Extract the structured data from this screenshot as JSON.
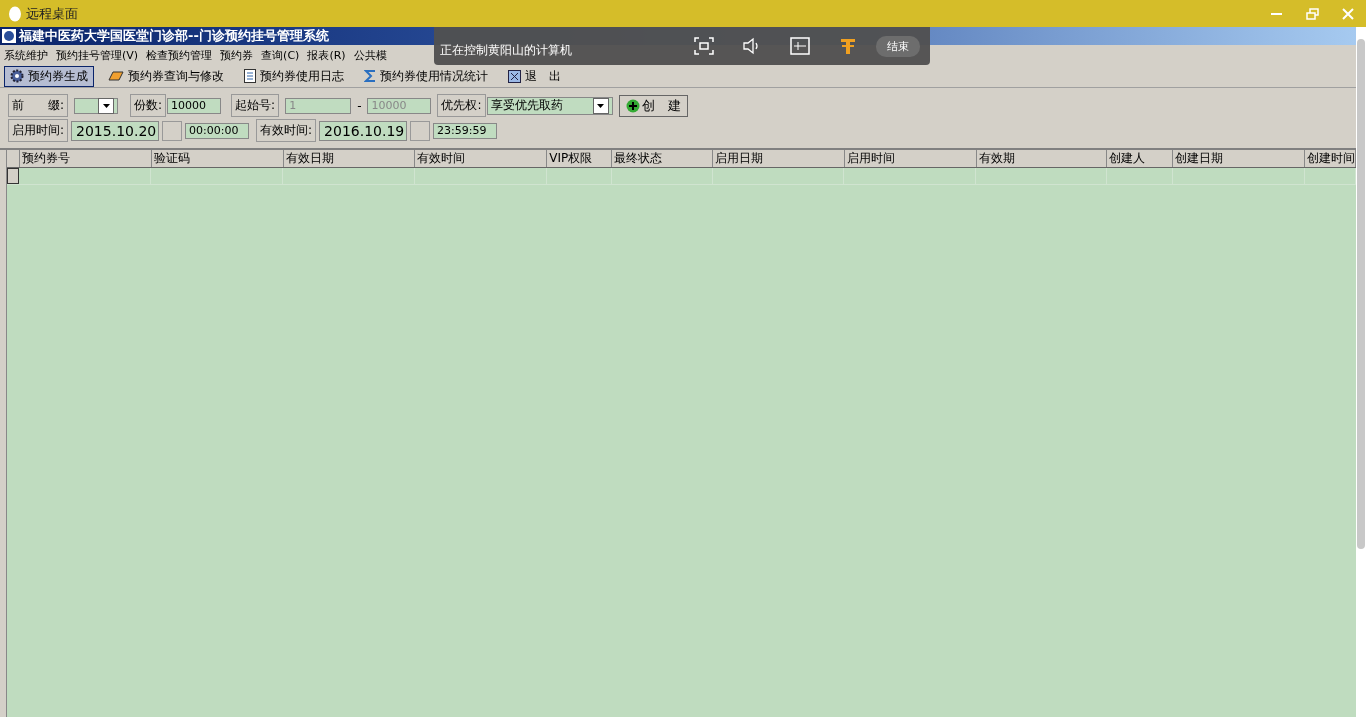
{
  "remote_window": {
    "title": "远程桌面"
  },
  "app_title": "福建中医药大学国医堂门诊部--门诊预约挂号管理系统",
  "menu": [
    "系统维护",
    "预约挂号管理(V)",
    "检查预约管理",
    "预约券",
    "查询(C)",
    "报表(R)",
    "公共模"
  ],
  "remote_bar": {
    "status": "正在控制黄阳山的计算机",
    "end_button": "结束"
  },
  "toolbar": [
    {
      "label": "预约券生成",
      "selected": true,
      "kind": "gear"
    },
    {
      "label": "预约券查询与修改",
      "selected": false,
      "kind": "eraser"
    },
    {
      "label": "预约券使用日志",
      "selected": false,
      "kind": "doc"
    },
    {
      "label": "预约券使用情况统计",
      "selected": false,
      "kind": "sigma"
    },
    {
      "label": "退　出",
      "selected": false,
      "kind": "exit"
    }
  ],
  "form": {
    "prefix_label": "前　　缀:",
    "count_label": "份数:",
    "count": "10000",
    "start_label": "起始号:",
    "start_from": "1",
    "dash": "-",
    "start_to": "10000",
    "start_disabled": true,
    "priority_label": "优先权:",
    "priority": "享受优先取药",
    "create_button": "创　建",
    "begin_label": "启用时间:",
    "begin_date": "2015.10.20",
    "begin_time": "00:00:00",
    "valid_label": "有效时间:",
    "valid_date": "2016.10.19",
    "valid_time": "23:59:59"
  },
  "table": {
    "columns": [
      "预约券号",
      "验证码",
      "有效日期",
      "有效时间",
      "VIP权限",
      "最终状态",
      "启用日期",
      "启用时间",
      "有效期",
      "创建人",
      "创建日期",
      "创建时间"
    ]
  }
}
